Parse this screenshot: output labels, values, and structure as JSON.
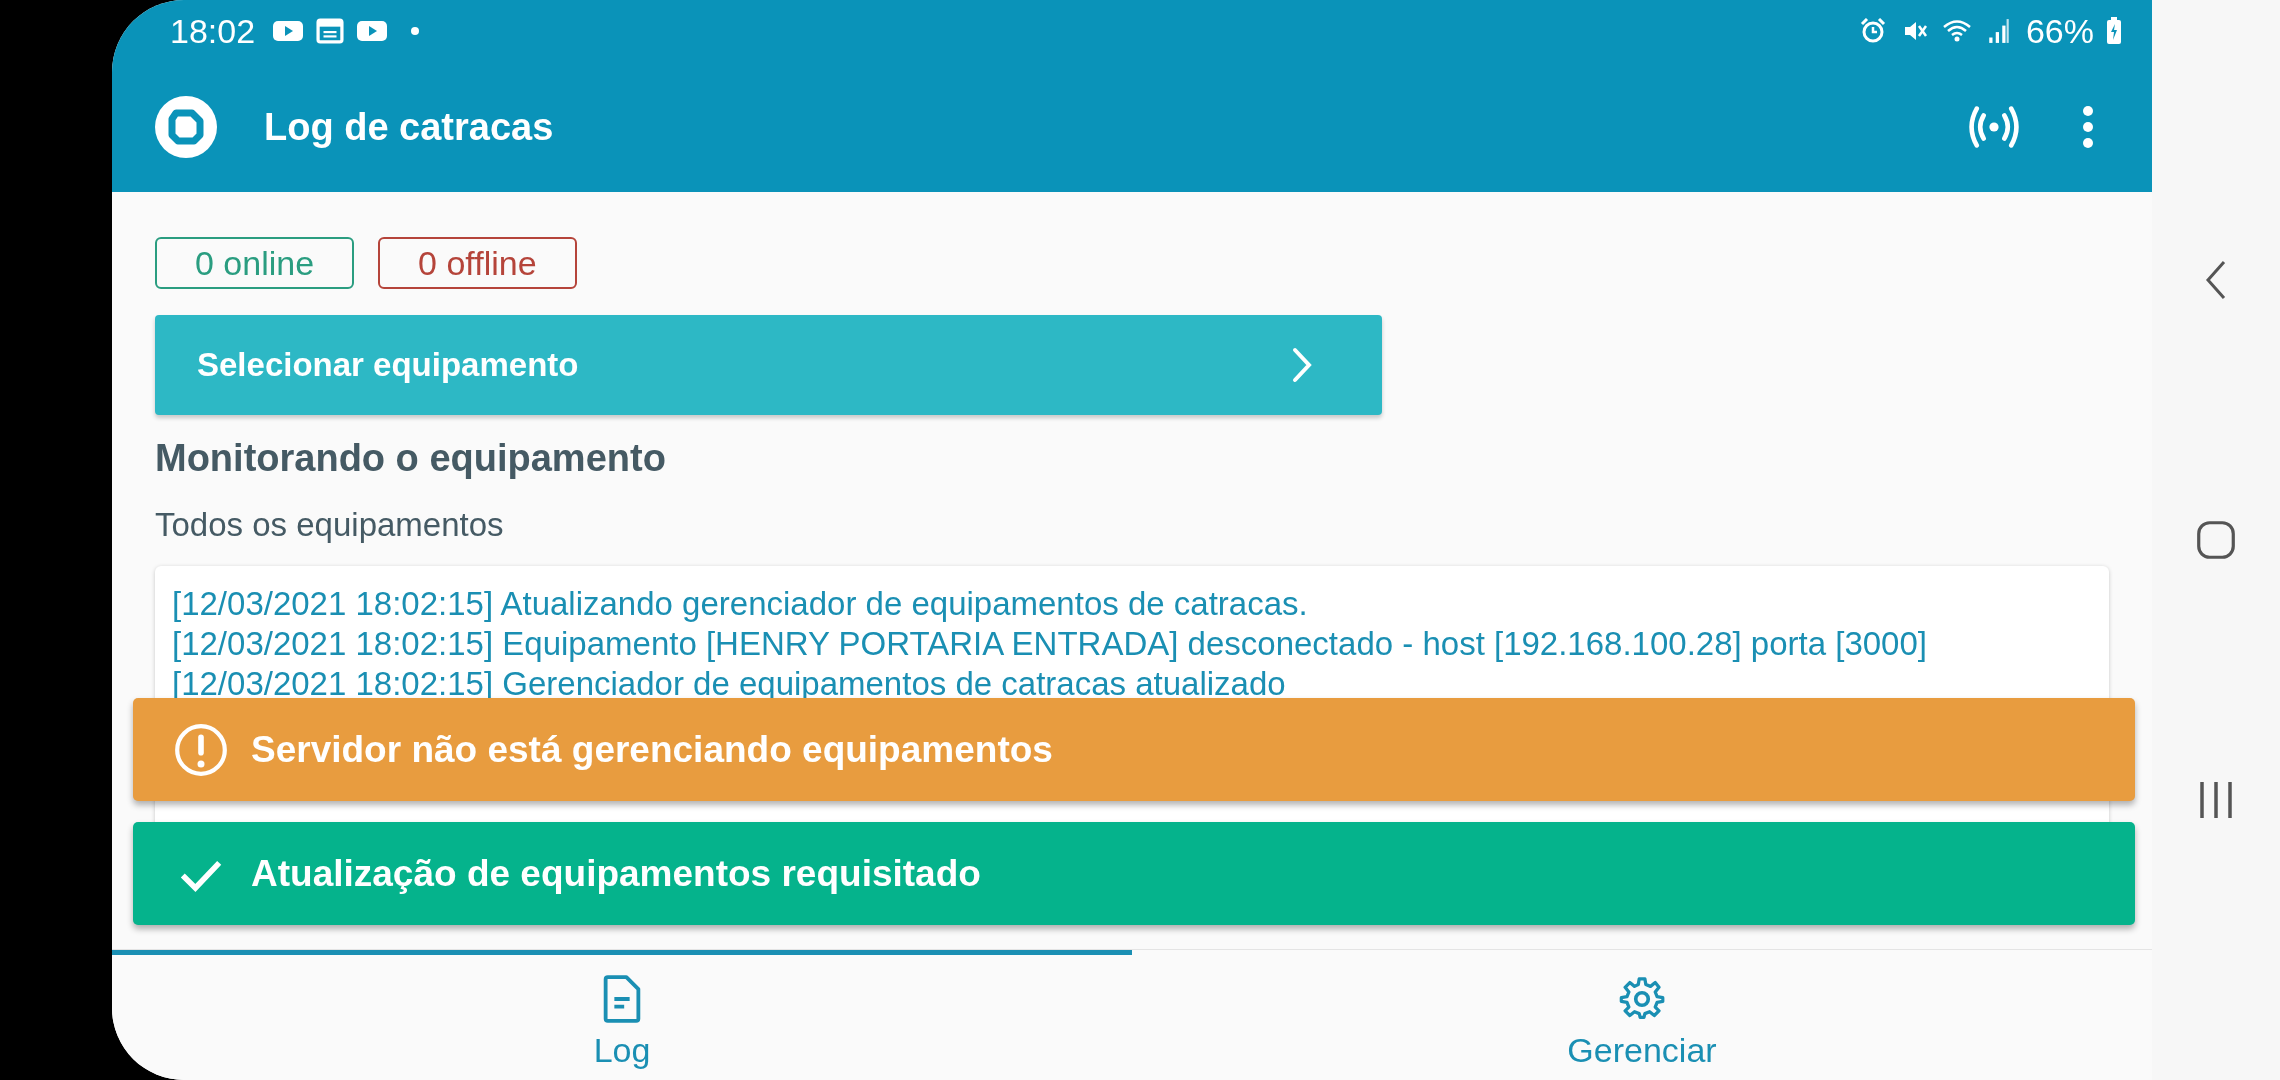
{
  "status_bar": {
    "time": "18:02",
    "battery": "66%"
  },
  "app_bar": {
    "title": "Log de catracas"
  },
  "status_badges": [
    {
      "label": "0 online",
      "color": "#2a9d80"
    },
    {
      "label": "0 offline",
      "color": "#b5443a"
    }
  ],
  "select_button": {
    "label": "Selecionar equipamento"
  },
  "monitor": {
    "heading": "Monitorando o equipamento",
    "subtitle": "Todos os equipamentos"
  },
  "log_lines": [
    "[12/03/2021 18:02:15] Atualizando gerenciador de equipamentos de catracas.",
    "[12/03/2021 18:02:15] Equipamento [HENRY PORTARIA ENTRADA] desconectado - host [192.168.100.28] porta [3000]",
    "[12/03/2021 18:02:15] Gerenciador de equipamentos de catracas atualizado"
  ],
  "toasts": [
    {
      "kind": "warning",
      "message": "Servidor não está gerenciando equipamentos"
    },
    {
      "kind": "success",
      "message": "Atualização de equipamentos requisitado"
    }
  ],
  "bottom_nav": [
    {
      "kind": "log",
      "label": "Log",
      "selected": true
    },
    {
      "kind": "settings",
      "label": "Gerenciar",
      "selected": false
    }
  ]
}
